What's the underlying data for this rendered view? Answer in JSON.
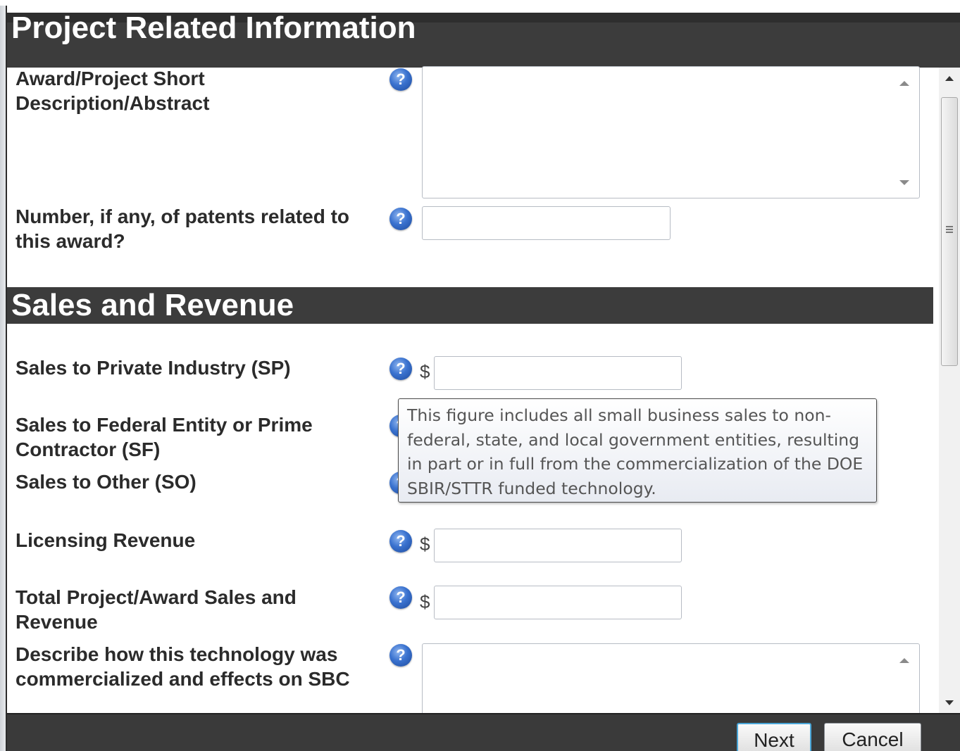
{
  "sections": {
    "project": {
      "title": "Project Related Information"
    },
    "sales": {
      "title": "Sales and Revenue"
    }
  },
  "fields": {
    "abstract": {
      "label": "Award/Project Short Description/Abstract",
      "value": ""
    },
    "patents": {
      "label": "Number, if any, of patents related to this award?",
      "value": ""
    },
    "sales_private": {
      "label": "Sales to Private Industry (SP)",
      "currency": "$",
      "value": ""
    },
    "sales_federal": {
      "label": "Sales to Federal Entity or Prime Contractor (SF)",
      "currency": "$",
      "value": ""
    },
    "sales_other": {
      "label": "Sales to Other (SO)",
      "currency": "$",
      "value": ""
    },
    "licensing": {
      "label": "Licensing Revenue",
      "currency": "$",
      "value": ""
    },
    "total": {
      "label": "Total Project/Award Sales and Revenue",
      "currency": "$",
      "value": ""
    },
    "commercialization": {
      "label": "Describe how this technology was commercialized and effects on SBC",
      "value": ""
    }
  },
  "tooltip": {
    "text": "This figure includes all small business sales to non-federal, state, and local government entities, resulting in part or in full from the commercialization of the DOE SBIR/STTR funded technology."
  },
  "footer": {
    "next_label": "Next",
    "cancel_label": "Cancel"
  },
  "icons": {
    "help": "help-question-icon"
  }
}
